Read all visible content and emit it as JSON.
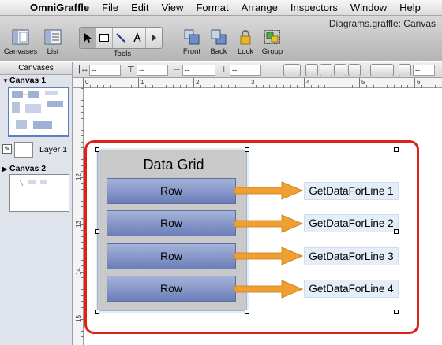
{
  "menubar": {
    "app_name": "OmniGraffle",
    "items": [
      "File",
      "Edit",
      "View",
      "Format",
      "Arrange",
      "Inspectors",
      "Window",
      "Help"
    ]
  },
  "window": {
    "title": "Diagrams.graffle: Canvas"
  },
  "toolbar": {
    "canvases_label": "Canvases",
    "list_label": "List",
    "tools_label": "Tools",
    "front_label": "Front",
    "back_label": "Back",
    "lock_label": "Lock",
    "group_label": "Group"
  },
  "sidebar": {
    "header": "Canvases",
    "canvas1_label": "Canvas 1",
    "layer1_label": "Layer 1",
    "canvas2_label": "Canvas 2"
  },
  "ruler": {
    "h_labels": [
      "0",
      "1",
      "2",
      "3",
      "4",
      "5",
      "6"
    ],
    "v_labels": [
      "12",
      "13",
      "14",
      "15"
    ]
  },
  "diagram": {
    "title": "Data Grid",
    "rows": [
      "Row",
      "Row",
      "Row",
      "Row"
    ],
    "targets": [
      "GetDataForLine 1",
      "GetDataForLine 2",
      "GetDataForLine 3",
      "GetDataForLine 4"
    ],
    "row_color": "#8092c6",
    "arrow_color": "#f0a032",
    "frame_color": "#e0211a",
    "label_bg": "#e4edf8"
  }
}
